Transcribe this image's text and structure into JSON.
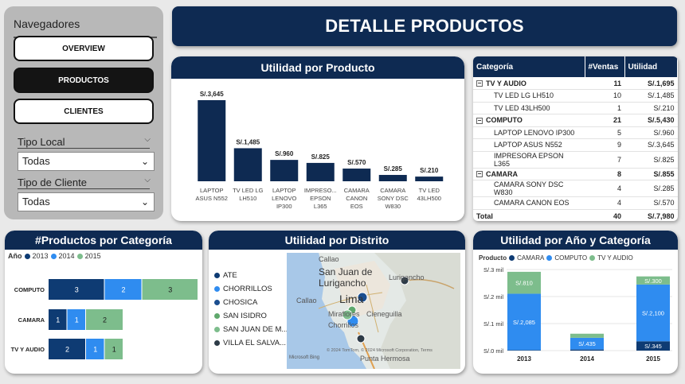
{
  "sidebar": {
    "title": "Navegadores",
    "buttons": [
      {
        "label": "OVERVIEW",
        "active": false
      },
      {
        "label": "PRODUCTOS",
        "active": true
      },
      {
        "label": "CLIENTES",
        "active": false
      }
    ],
    "filters": [
      {
        "label": "Tipo Local",
        "value": "Todas"
      },
      {
        "label": "Tipo de Cliente",
        "value": "Todas"
      }
    ]
  },
  "header": {
    "title": "DETALLE PRODUCTOS"
  },
  "colors": {
    "navy": "#0e2a52",
    "blue2013": "#0e3b73",
    "blue2014": "#2f8cf0",
    "green2015": "#7dbd8c"
  },
  "utilidad_producto": {
    "title": "Utilidad por Producto",
    "chart_data": {
      "type": "bar",
      "categories": [
        "LAPTOP ASUS N552",
        "TV LED LG LH510",
        "LAPTOP LENOVO IP300",
        "IMPRESO... EPSON L365",
        "CAMARA CANON EOS",
        "CAMARA SONY DSC W830",
        "TV LED 43LH500"
      ],
      "category_lines": [
        [
          "LAPTOP",
          "ASUS N552"
        ],
        [
          "TV LED LG",
          "LH510"
        ],
        [
          "LAPTOP",
          "LENOVO",
          "IP300"
        ],
        [
          "IMPRESO...",
          "EPSON",
          "L365"
        ],
        [
          "CAMARA",
          "CANON",
          "EOS"
        ],
        [
          "CAMARA",
          "SONY DSC",
          "W830"
        ],
        [
          "TV LED",
          "43LH500"
        ]
      ],
      "values": [
        3645,
        1485,
        960,
        825,
        570,
        285,
        210
      ],
      "value_labels": [
        "S/.3,645",
        "S/.1,485",
        "S/.960",
        "S/.825",
        "S/.570",
        "S/.285",
        "S/.210"
      ]
    }
  },
  "tabla": {
    "headers": [
      "Categoría",
      "#Ventas",
      "Utilidad"
    ],
    "rows": [
      {
        "type": "grp",
        "name": "TV Y AUDIO",
        "ventas": "11",
        "utilidad": "S/.1,695"
      },
      {
        "type": "sub",
        "name": "TV LED LG LH510",
        "ventas": "10",
        "utilidad": "S/.1,485"
      },
      {
        "type": "sub",
        "name": "TV LED 43LH500",
        "ventas": "1",
        "utilidad": "S/.210"
      },
      {
        "type": "grp",
        "name": "COMPUTO",
        "ventas": "21",
        "utilidad": "S/.5,430"
      },
      {
        "type": "sub",
        "name": "LAPTOP LENOVO IP300",
        "ventas": "5",
        "utilidad": "S/.960"
      },
      {
        "type": "sub",
        "name": "LAPTOP ASUS N552",
        "ventas": "9",
        "utilidad": "S/.3,645"
      },
      {
        "type": "sub",
        "name": "IMPRESORA EPSON L365",
        "ventas": "7",
        "utilidad": "S/.825"
      },
      {
        "type": "grp",
        "name": "CAMARA",
        "ventas": "8",
        "utilidad": "S/.855"
      },
      {
        "type": "sub",
        "name": "CAMARA SONY DSC W830",
        "ventas": "4",
        "utilidad": "S/.285"
      },
      {
        "type": "sub",
        "name": "CAMARA CANON EOS",
        "ventas": "4",
        "utilidad": "S/.570"
      },
      {
        "type": "total",
        "name": "Total",
        "ventas": "40",
        "utilidad": "S/.7,980"
      }
    ]
  },
  "productos_categoria": {
    "title": "#Productos por Categoría",
    "legend_label": "Año",
    "chart_data": {
      "type": "bar",
      "orientation": "horizontal-stacked",
      "categories": [
        "COMPUTO",
        "CAMARA",
        "TV Y AUDIO"
      ],
      "series": [
        {
          "name": "2013",
          "values": [
            3,
            1,
            2
          ]
        },
        {
          "name": "2014",
          "values": [
            2,
            1,
            1
          ]
        },
        {
          "name": "2015",
          "values": [
            3,
            2,
            1
          ]
        }
      ]
    }
  },
  "distrito": {
    "title": "Utilidad por Distrito",
    "items": [
      {
        "name": "ATE",
        "color": "#0e3b73"
      },
      {
        "name": "CHORRILLOS",
        "color": "#2f8cf0"
      },
      {
        "name": "CHOSICA",
        "color": "#1b4e8f"
      },
      {
        "name": "SAN ISIDRO",
        "color": "#5fa86c"
      },
      {
        "name": "SAN JUAN DE M...",
        "color": "#7dbd8c"
      },
      {
        "name": "VILLA EL SALVA...",
        "color": "#2d3b47"
      }
    ],
    "map_labels": [
      "Callao",
      "San Juan de",
      "Lurigancho",
      "Lurigancho",
      "Callao",
      "Lima",
      "Miraflores",
      "Cieneguilla",
      "Chorrillos",
      "Punta Hermosa"
    ],
    "attribution": "© 2024 TomTom, © 2024 Microsoft Corporation, Terms",
    "brand": "Microsoft Bing"
  },
  "utilidad_anio": {
    "title": "Utilidad por Año y Categoría",
    "legend_label": "Producto",
    "chart_data": {
      "type": "bar",
      "orientation": "vertical-stacked",
      "categories": [
        "2013",
        "2014",
        "2015"
      ],
      "series": [
        {
          "name": "CAMARA",
          "values": [
            20,
            40,
            345
          ]
        },
        {
          "name": "COMPUTO",
          "values": [
            2085,
            435,
            2100
          ]
        },
        {
          "name": "TV Y AUDIO",
          "values": [
            810,
            150,
            300
          ]
        }
      ],
      "value_labels": {
        "CAMARA": [
          "",
          "",
          "S/.345"
        ],
        "COMPUTO": [
          "S/.2,085",
          "S/.435",
          "S/.2,100"
        ],
        "TV Y AUDIO": [
          "S/.810",
          "",
          "S/.300"
        ]
      },
      "y_ticks": [
        "S/.0 mil",
        "S/.1 mil",
        "S/.2 mil",
        "S/.3 mil"
      ],
      "ylim": [
        0,
        3000
      ]
    }
  }
}
